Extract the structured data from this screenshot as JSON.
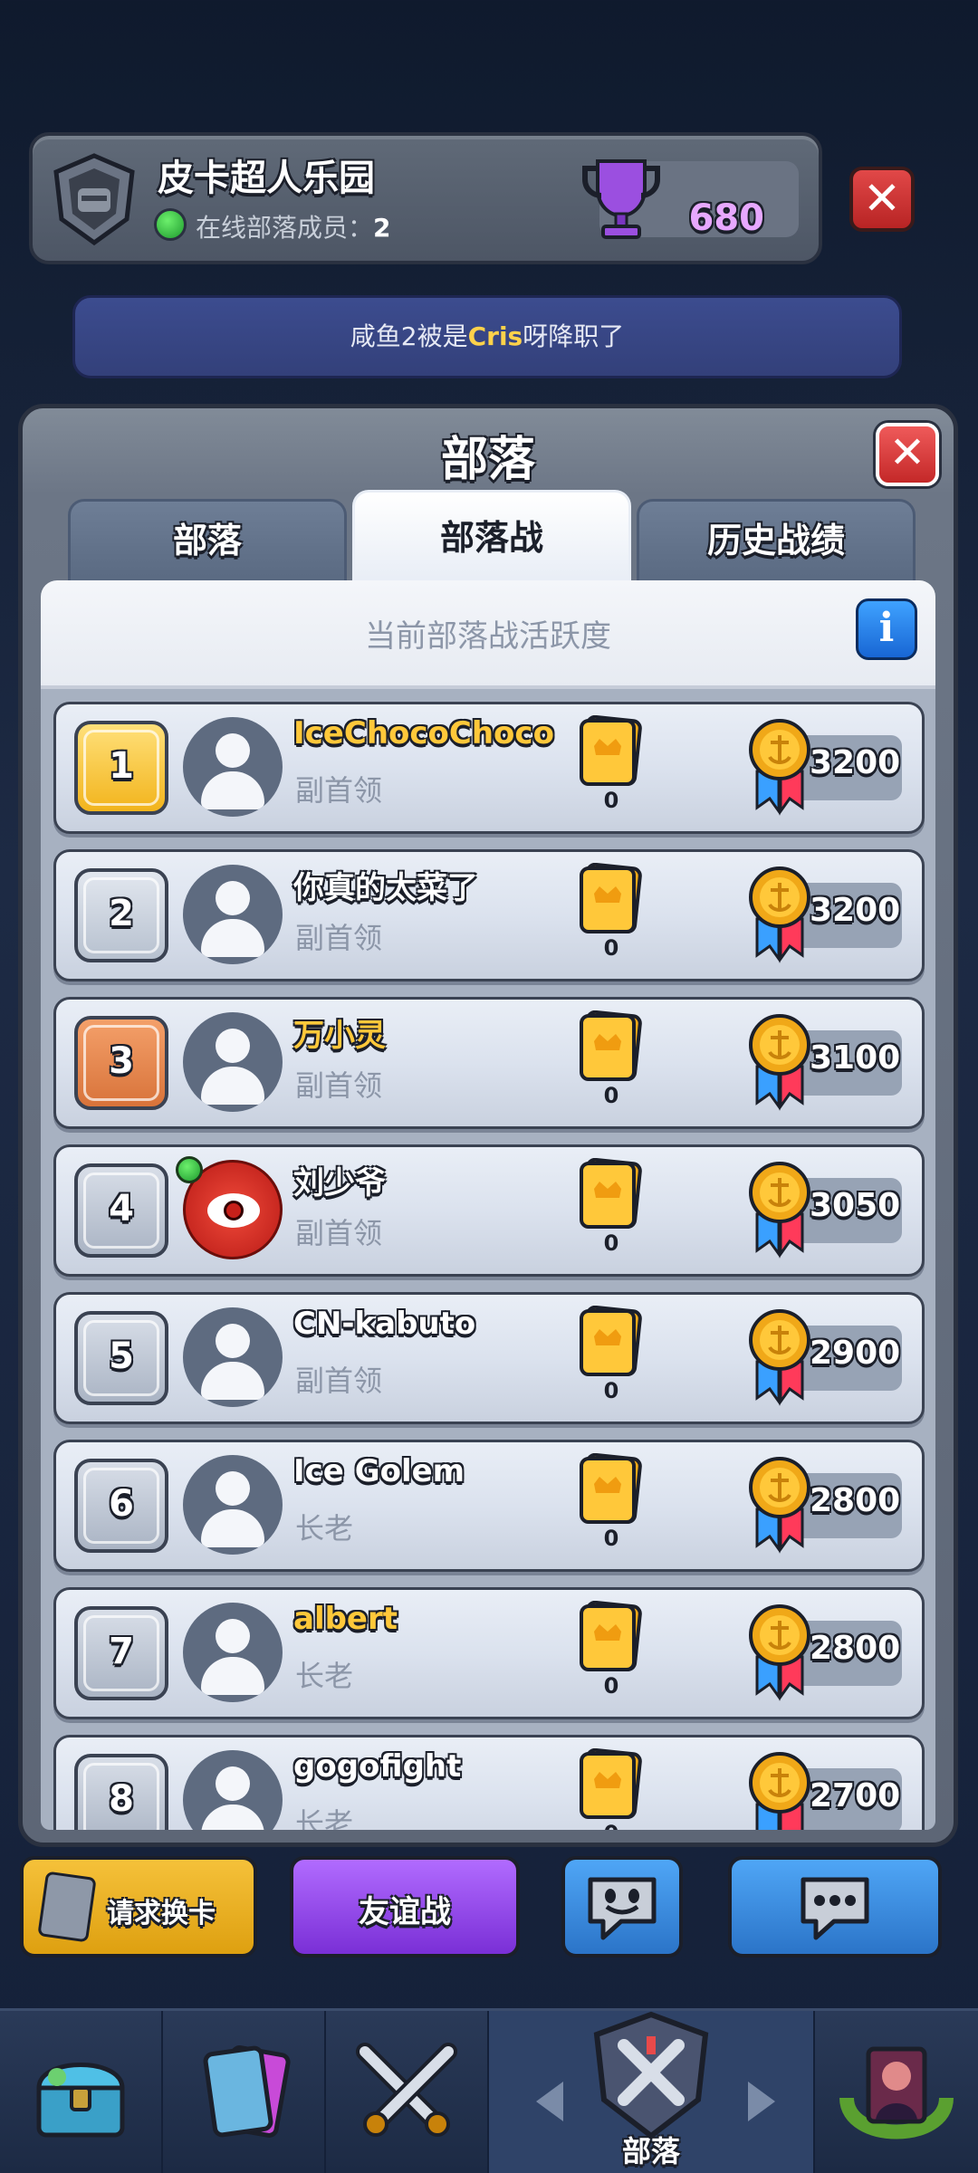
{
  "header": {
    "clan_name": "皮卡超人乐园",
    "online_label": "在线部落成员：",
    "online_count": "2",
    "trophies": "680"
  },
  "notification": {
    "part1": "咸鱼2被是",
    "highlight": "Cris",
    "part2": "呀降职了"
  },
  "panel": {
    "title": "部落",
    "tabs": [
      {
        "label": "部落",
        "active": false
      },
      {
        "label": "部落战",
        "active": true
      },
      {
        "label": "历史战绩",
        "active": false
      }
    ],
    "activity_title": "当前部落战活跃度",
    "info_label": "i"
  },
  "members": [
    {
      "rank": "1",
      "name": "IceChocoChoco",
      "role": "副首领",
      "cards": "0",
      "medals": "3200"
    },
    {
      "rank": "2",
      "name": "你真的太菜了",
      "role": "副首领",
      "cards": "0",
      "medals": "3200"
    },
    {
      "rank": "3",
      "name": "万小灵",
      "role": "副首领",
      "cards": "0",
      "medals": "3100"
    },
    {
      "rank": "4",
      "name": "刘少爷",
      "role": "副首领",
      "cards": "0",
      "medals": "3050"
    },
    {
      "rank": "5",
      "name": "CN-kabuto",
      "role": "副首领",
      "cards": "0",
      "medals": "2900"
    },
    {
      "rank": "6",
      "name": "Ice Golem",
      "role": "长老",
      "cards": "0",
      "medals": "2800"
    },
    {
      "rank": "7",
      "name": "albert",
      "role": "长老",
      "cards": "0",
      "medals": "2800"
    },
    {
      "rank": "8",
      "name": "gogofight",
      "role": "长老",
      "cards": "0",
      "medals": "2700"
    }
  ],
  "actions": {
    "request_card": "请求换卡",
    "friendly_battle": "友谊战"
  },
  "nav": {
    "clan_label": "部落"
  },
  "colors": {
    "accent_gold": "#ffc83a",
    "friendly_purple": "#9a4ef0",
    "chat_blue": "#3b8ee0",
    "close_red": "#d83636"
  }
}
